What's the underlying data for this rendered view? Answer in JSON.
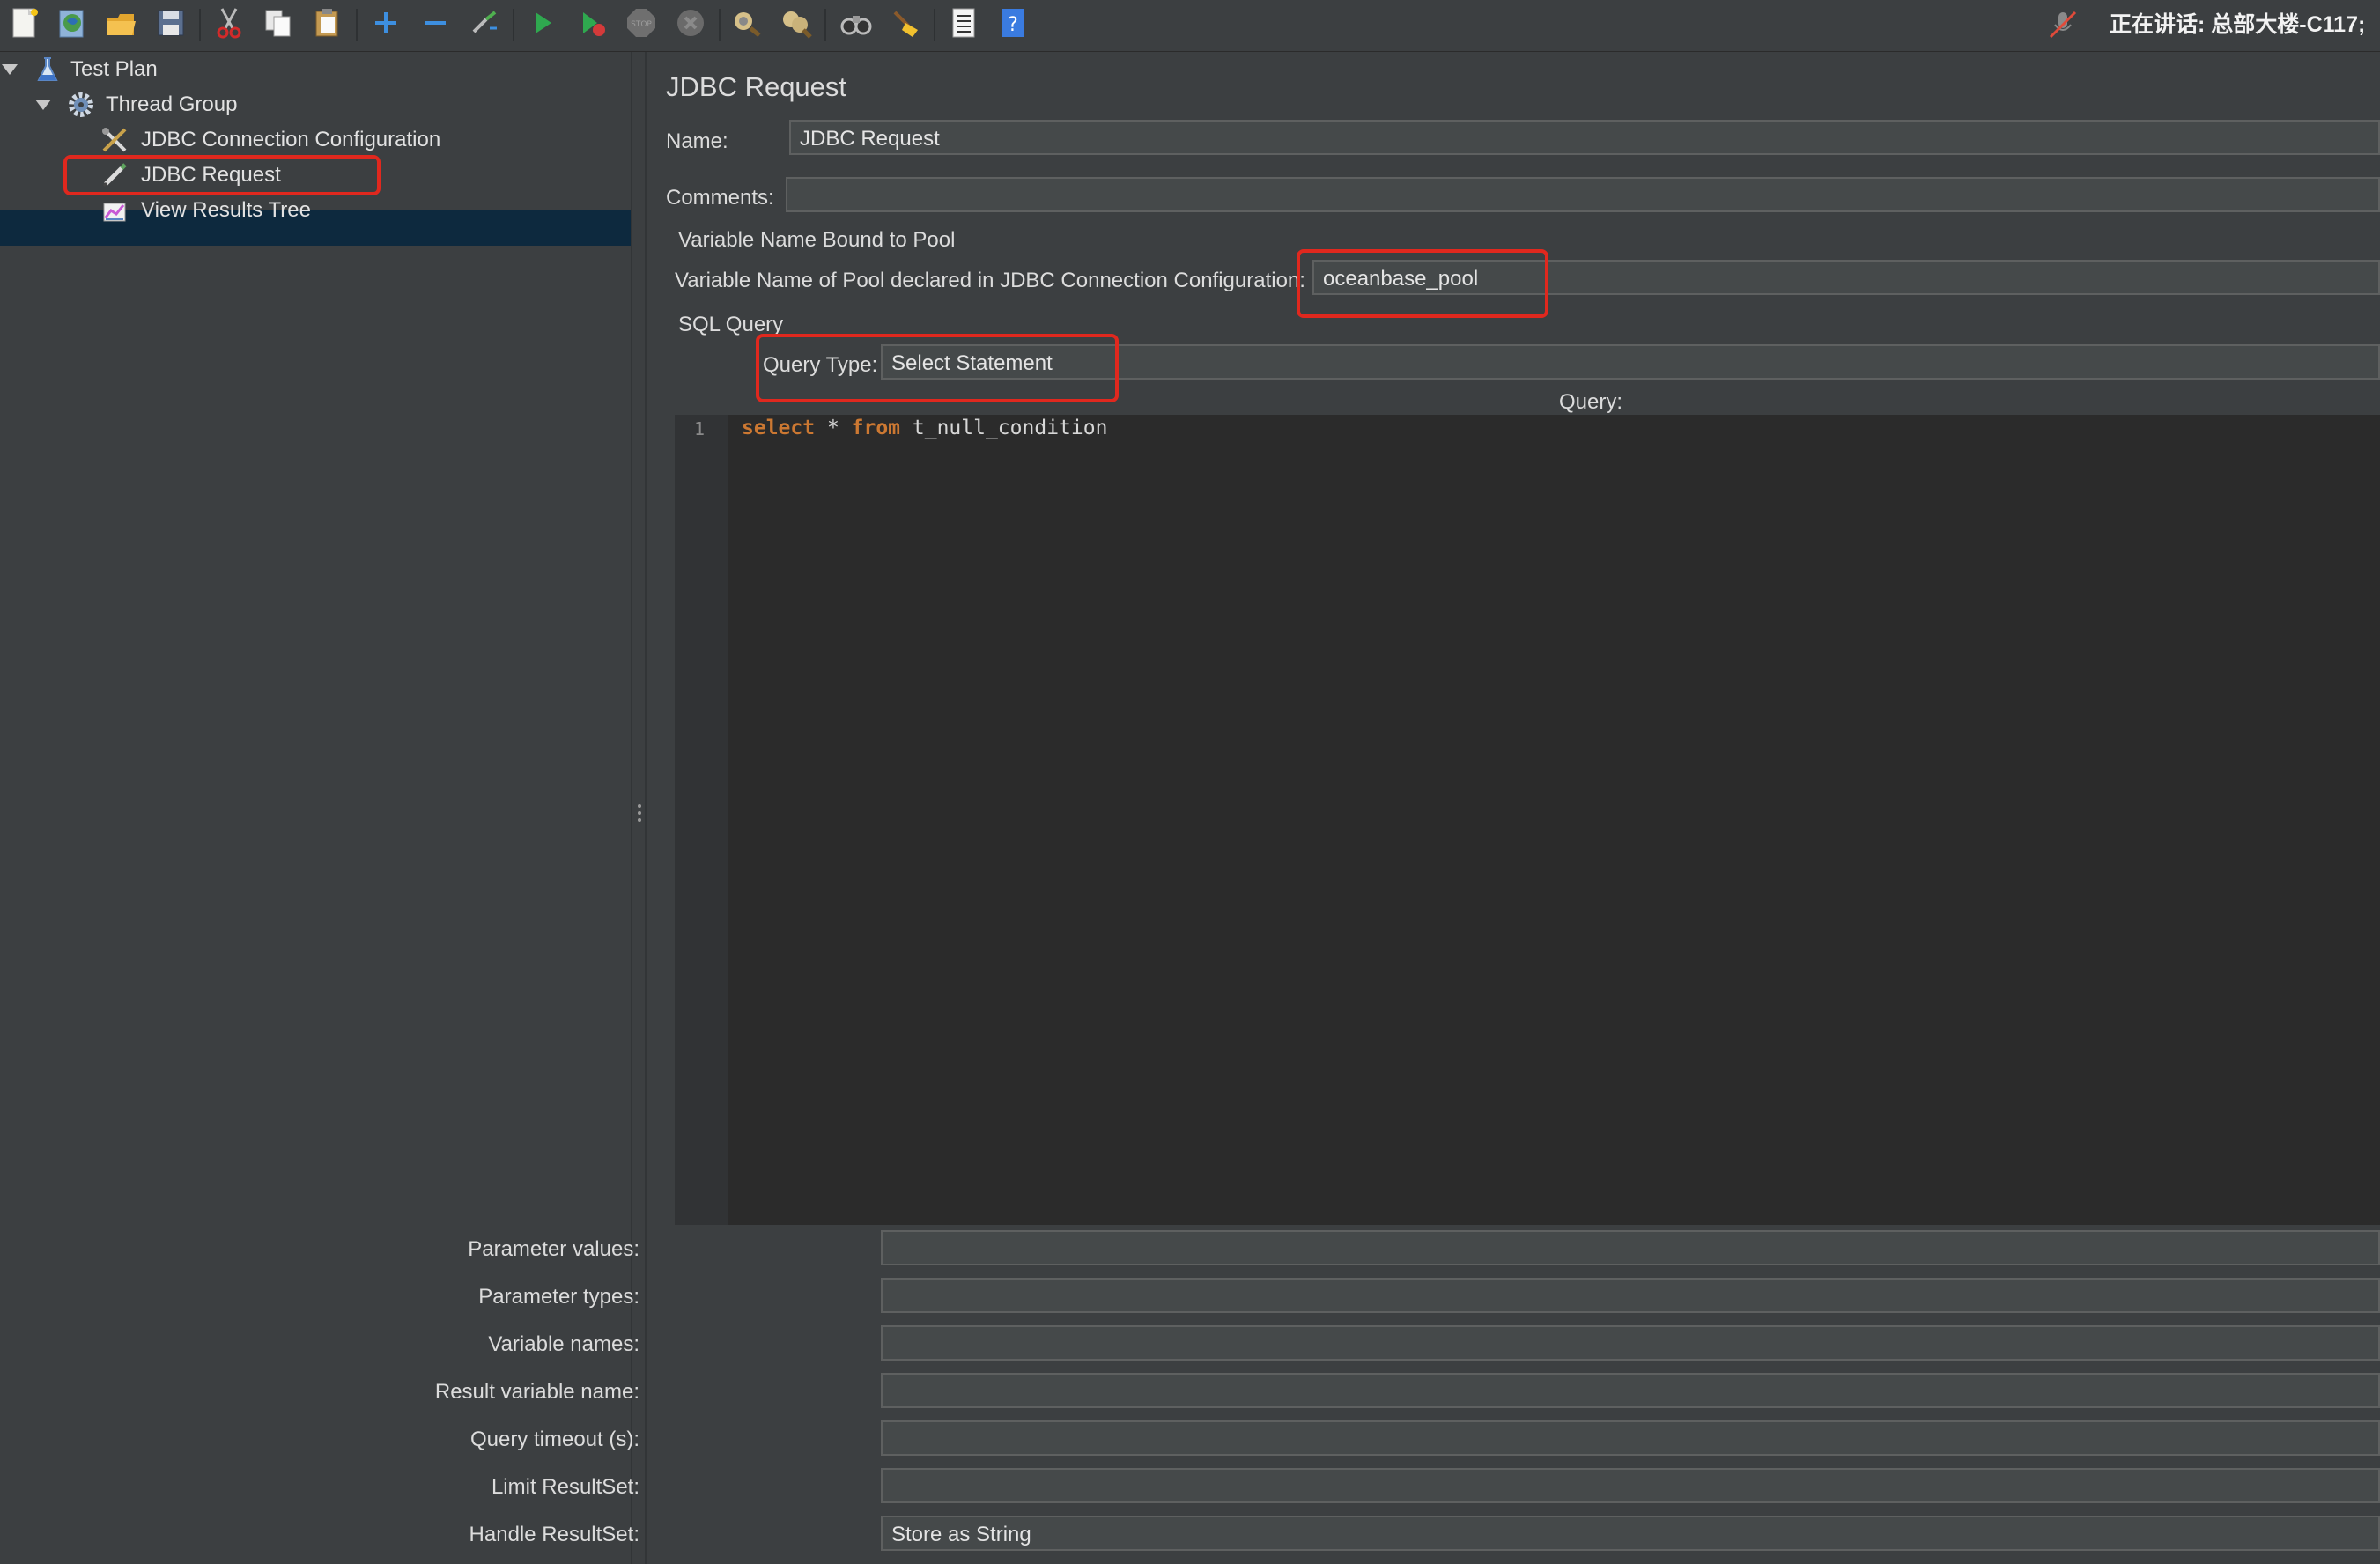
{
  "colors": {
    "accent_highlight": "#e0281e",
    "selection_bg": "#0d293e",
    "keyword": "#cc7832"
  },
  "toolbar": {
    "icons": [
      "new-icon",
      "templates-icon",
      "open-icon",
      "save-icon",
      "cut-icon",
      "copy-icon",
      "paste-icon",
      "expand-icon",
      "collapse-icon",
      "toggle-icon",
      "start-icon",
      "start-no-pauses-icon",
      "stop-icon",
      "shutdown-icon",
      "clear-icon",
      "clear-all-icon",
      "search-icon",
      "reset-search-icon",
      "function-helper-icon",
      "help-icon"
    ],
    "mic_icon": "mic-muted-icon",
    "talking_text": "正在讲话: 总部大楼-C117;"
  },
  "tree": {
    "items": [
      {
        "label": "Test Plan",
        "icon": "flask-icon"
      },
      {
        "label": "Thread Group",
        "icon": "gear-icon"
      },
      {
        "label": "JDBC Connection Configuration",
        "icon": "tools-icon"
      },
      {
        "label": "JDBC Request",
        "icon": "pen-icon"
      },
      {
        "label": "View Results Tree",
        "icon": "graph-icon"
      }
    ]
  },
  "panel": {
    "title": "JDBC Request",
    "name_label": "Name:",
    "name_value": "JDBC Request",
    "comments_label": "Comments:",
    "comments_value": "",
    "pool_section": "Variable Name Bound to Pool",
    "pool_label": "Variable Name of Pool declared in JDBC Connection Configuration:",
    "pool_value": "oceanbase_pool",
    "sql_section": "SQL Query",
    "query_type_label": "Query Type:",
    "query_type_value": "Select Statement",
    "query_label": "Query:",
    "query": {
      "line_number": "1",
      "kw_select": "select",
      "star": " * ",
      "kw_from": "from",
      "table": " t_null_condition"
    },
    "params": [
      {
        "label": "Parameter values:",
        "value": ""
      },
      {
        "label": "Parameter types:",
        "value": ""
      },
      {
        "label": "Variable names:",
        "value": ""
      },
      {
        "label": "Result variable name:",
        "value": ""
      },
      {
        "label": "Query timeout (s):",
        "value": ""
      },
      {
        "label": "Limit ResultSet:",
        "value": ""
      },
      {
        "label": "Handle ResultSet:",
        "value": "Store as String"
      }
    ]
  }
}
